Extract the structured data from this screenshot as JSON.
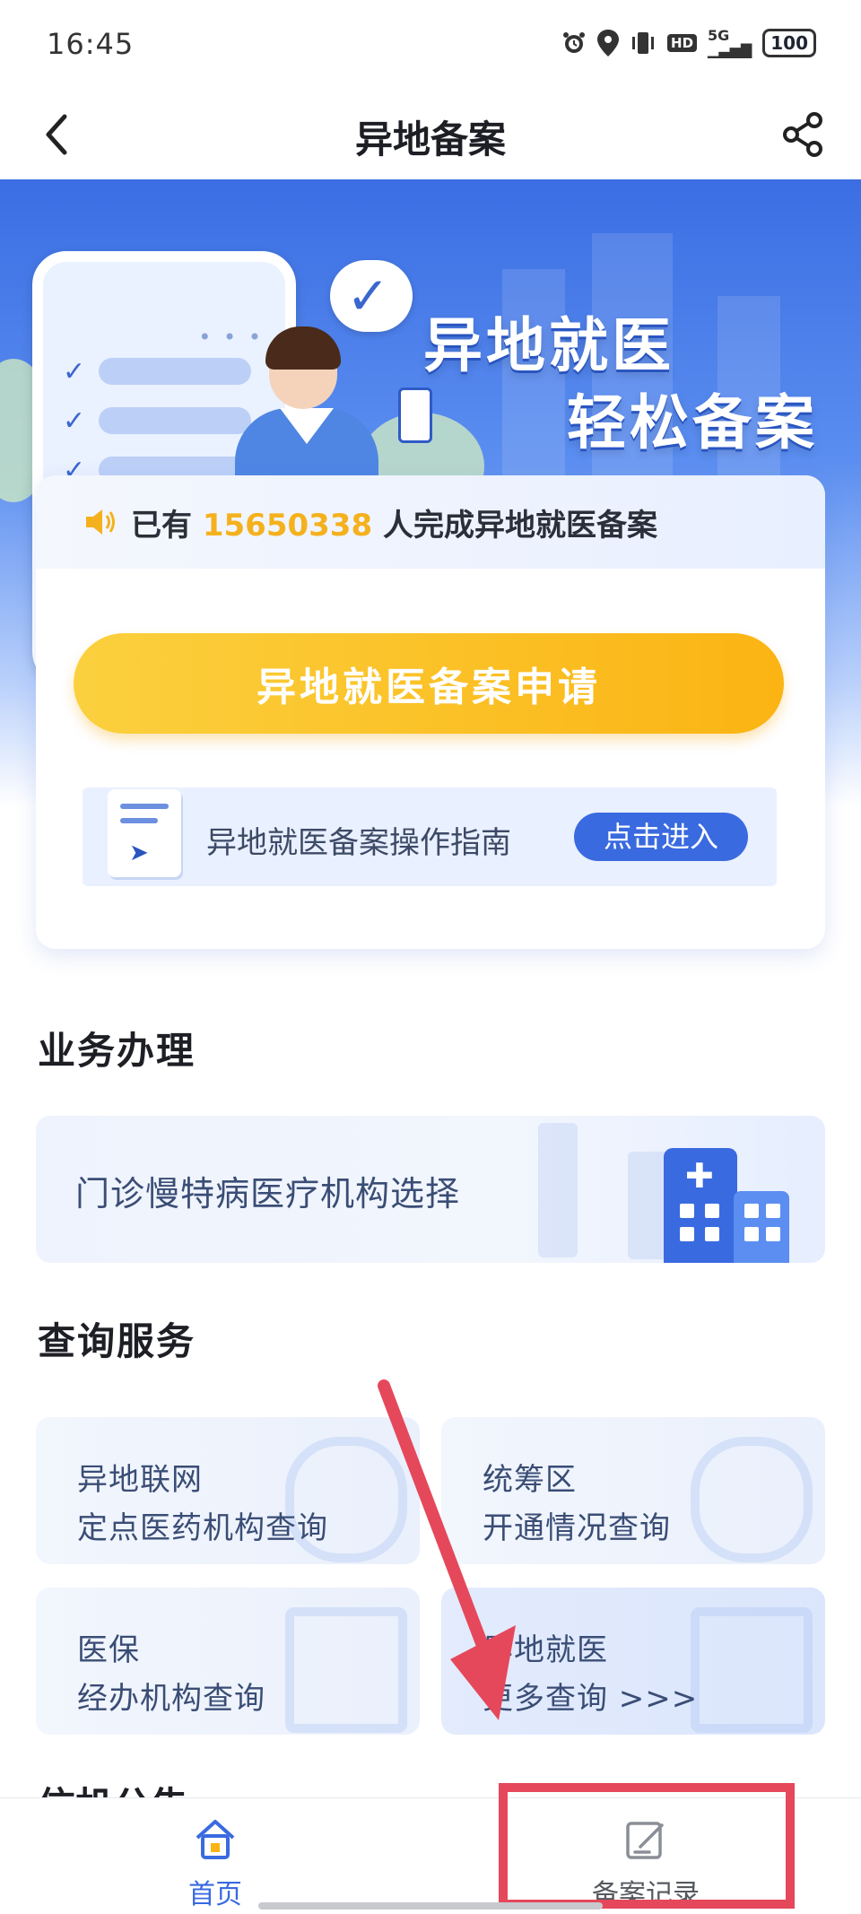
{
  "status_bar": {
    "time": "16:45",
    "network": "5G",
    "hd": "HD",
    "battery": "100"
  },
  "nav": {
    "title": "异地备案",
    "back_icon": "chevron-left-icon",
    "share_icon": "share-icon"
  },
  "hero": {
    "title_line1": "异地就医",
    "title_line2": "轻松备案"
  },
  "notice": {
    "prefix": "已有",
    "count": "15650338",
    "suffix": "人完成异地就医备案"
  },
  "apply_button": "异地就医备案申请",
  "guide": {
    "label": "异地就医备案操作指南",
    "button": "点击进入"
  },
  "sections": {
    "business": "业务办理",
    "query": "查询服务",
    "hidden": "信机公告"
  },
  "business_items": [
    {
      "label": "门诊慢特病医疗机构选择"
    }
  ],
  "query_items": [
    {
      "line1": "异地联网",
      "line2": "定点医药机构查询"
    },
    {
      "line1": "统筹区",
      "line2": "开通情况查询"
    },
    {
      "line1": "医保",
      "line2": "经办机构查询"
    },
    {
      "line1": "异地就医",
      "line2": "更多查询 >>>"
    }
  ],
  "tabbar": {
    "home": "首页",
    "records": "备案记录"
  },
  "colors": {
    "primary": "#3a6ae0",
    "accent": "#fbb413",
    "annotation": "#e5485a"
  }
}
